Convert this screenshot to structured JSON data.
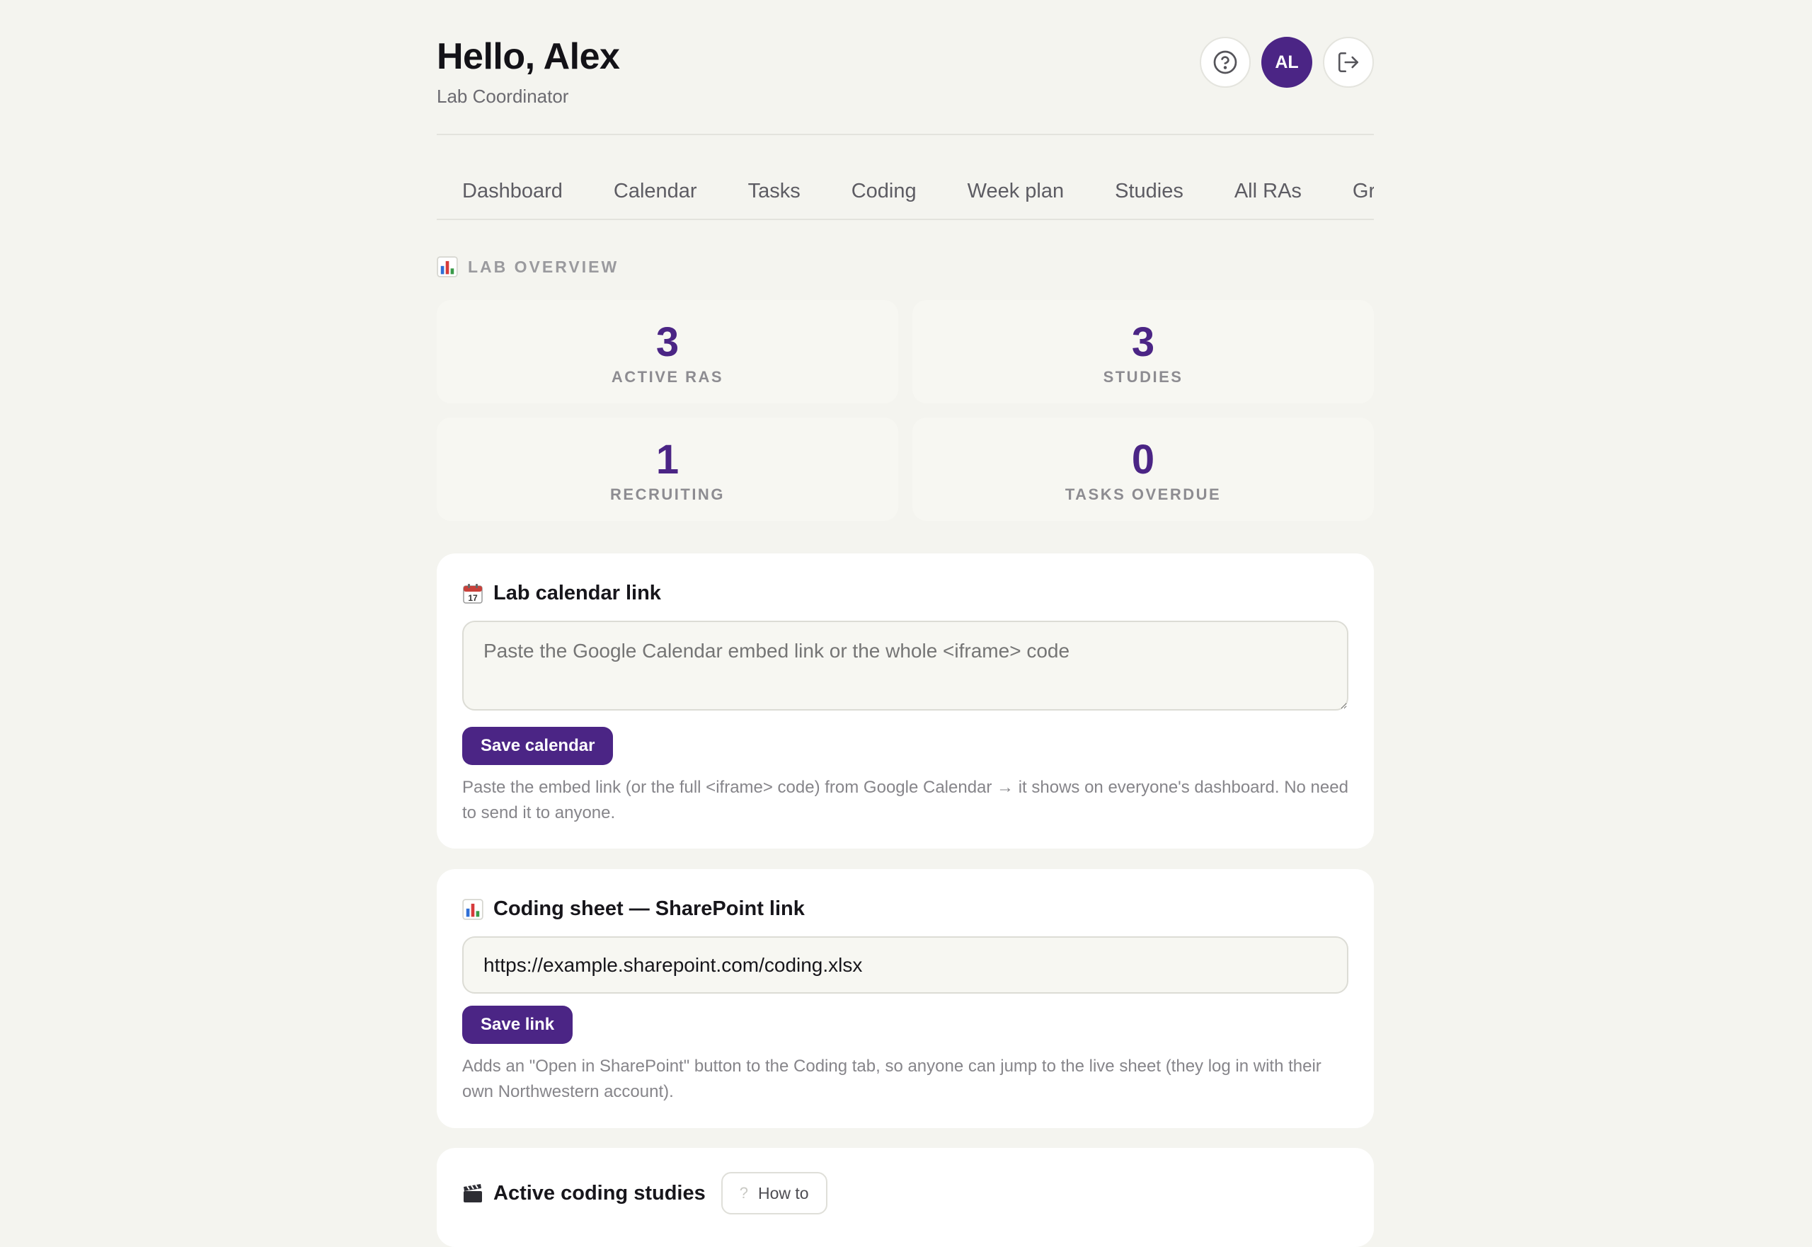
{
  "header": {
    "greeting": "Hello, Alex",
    "role": "Lab Coordinator",
    "avatar_initials": "AL",
    "help_icon": "help-circle-icon",
    "logout_icon": "logout-icon"
  },
  "tabs": [
    "Dashboard",
    "Calendar",
    "Tasks",
    "Coding",
    "Week plan",
    "Studies",
    "All RAs",
    "Gra"
  ],
  "overview": {
    "label": "LAB OVERVIEW",
    "icon": "bar-chart-icon",
    "stats": [
      {
        "value": "3",
        "label": "ACTIVE RAS"
      },
      {
        "value": "3",
        "label": "STUDIES"
      },
      {
        "value": "1",
        "label": "RECRUITING"
      },
      {
        "value": "0",
        "label": "TASKS OVERDUE"
      }
    ]
  },
  "calendar_card": {
    "icon": "calendar-icon",
    "title": "Lab calendar link",
    "placeholder": "Paste the Google Calendar embed link or the whole <iframe> code",
    "button": "Save calendar",
    "help": "Paste the embed link (or the full <iframe> code) from Google Calendar → it shows on everyone's dashboard. No need to send it to anyone."
  },
  "coding_card": {
    "icon": "bar-chart-icon",
    "title": "Coding sheet — SharePoint link",
    "value": "https://example.sharepoint.com/coding.xlsx",
    "button": "Save link",
    "help": "Adds an \"Open in SharePoint\" button to the Coding tab, so anyone can jump to the live sheet (they log in with their own Northwestern account)."
  },
  "studies_card": {
    "icon": "clapper-board-icon",
    "title": "Active coding studies",
    "howto": "How to",
    "howto_icon": "question-mark-icon"
  },
  "colors": {
    "accent": "#4b2585",
    "background": "#f4f4ef"
  }
}
